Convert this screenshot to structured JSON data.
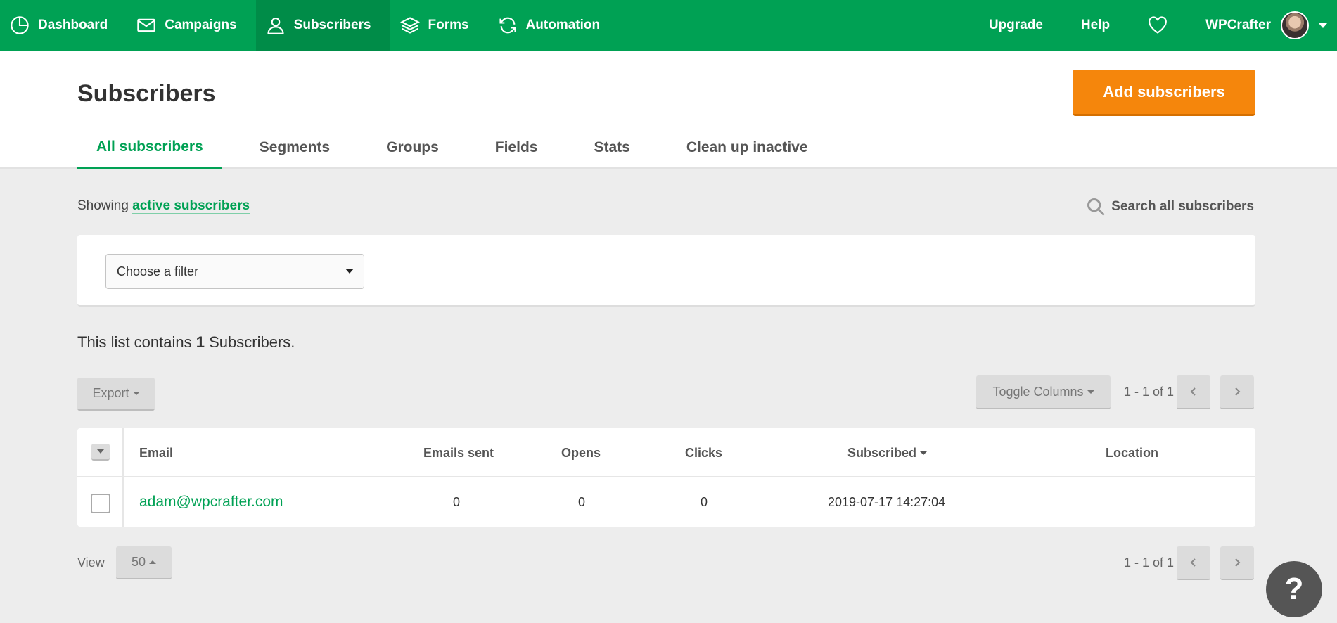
{
  "nav": {
    "items": [
      {
        "label": "Dashboard",
        "icon": "pie-chart-icon"
      },
      {
        "label": "Campaigns",
        "icon": "envelope-icon"
      },
      {
        "label": "Subscribers",
        "icon": "user-icon",
        "active": true
      },
      {
        "label": "Forms",
        "icon": "layers-icon"
      },
      {
        "label": "Automation",
        "icon": "refresh-icon"
      }
    ],
    "upgrade": "Upgrade",
    "help": "Help",
    "user": "WPCrafter"
  },
  "header": {
    "title": "Subscribers",
    "add_button": "Add subscribers",
    "tabs": [
      "All subscribers",
      "Segments",
      "Groups",
      "Fields",
      "Stats",
      "Clean up inactive"
    ]
  },
  "showing": {
    "prefix": "Showing",
    "link": "active subscribers",
    "search": "Search all subscribers"
  },
  "filter": {
    "value": "Choose a filter"
  },
  "list": {
    "prefix": "This list contains",
    "count": "1",
    "suffix": "Subscribers."
  },
  "toolbar": {
    "export": "Export",
    "toggle_columns": "Toggle Columns",
    "pager": "1 - 1 of 1"
  },
  "table": {
    "columns": [
      "Email",
      "Emails sent",
      "Opens",
      "Clicks",
      "Subscribed",
      "Location"
    ],
    "rows": [
      {
        "email": "adam@wpcrafter.com",
        "sent": "0",
        "opens": "0",
        "clicks": "0",
        "subscribed": "2019-07-17 14:27:04",
        "location": ""
      }
    ]
  },
  "footer": {
    "view_label": "View",
    "per_page": "50",
    "pager": "1 - 1 of 1"
  },
  "help_bubble": "?",
  "colors": {
    "brand_green": "#00a154",
    "accent_orange": "#f5860c"
  }
}
